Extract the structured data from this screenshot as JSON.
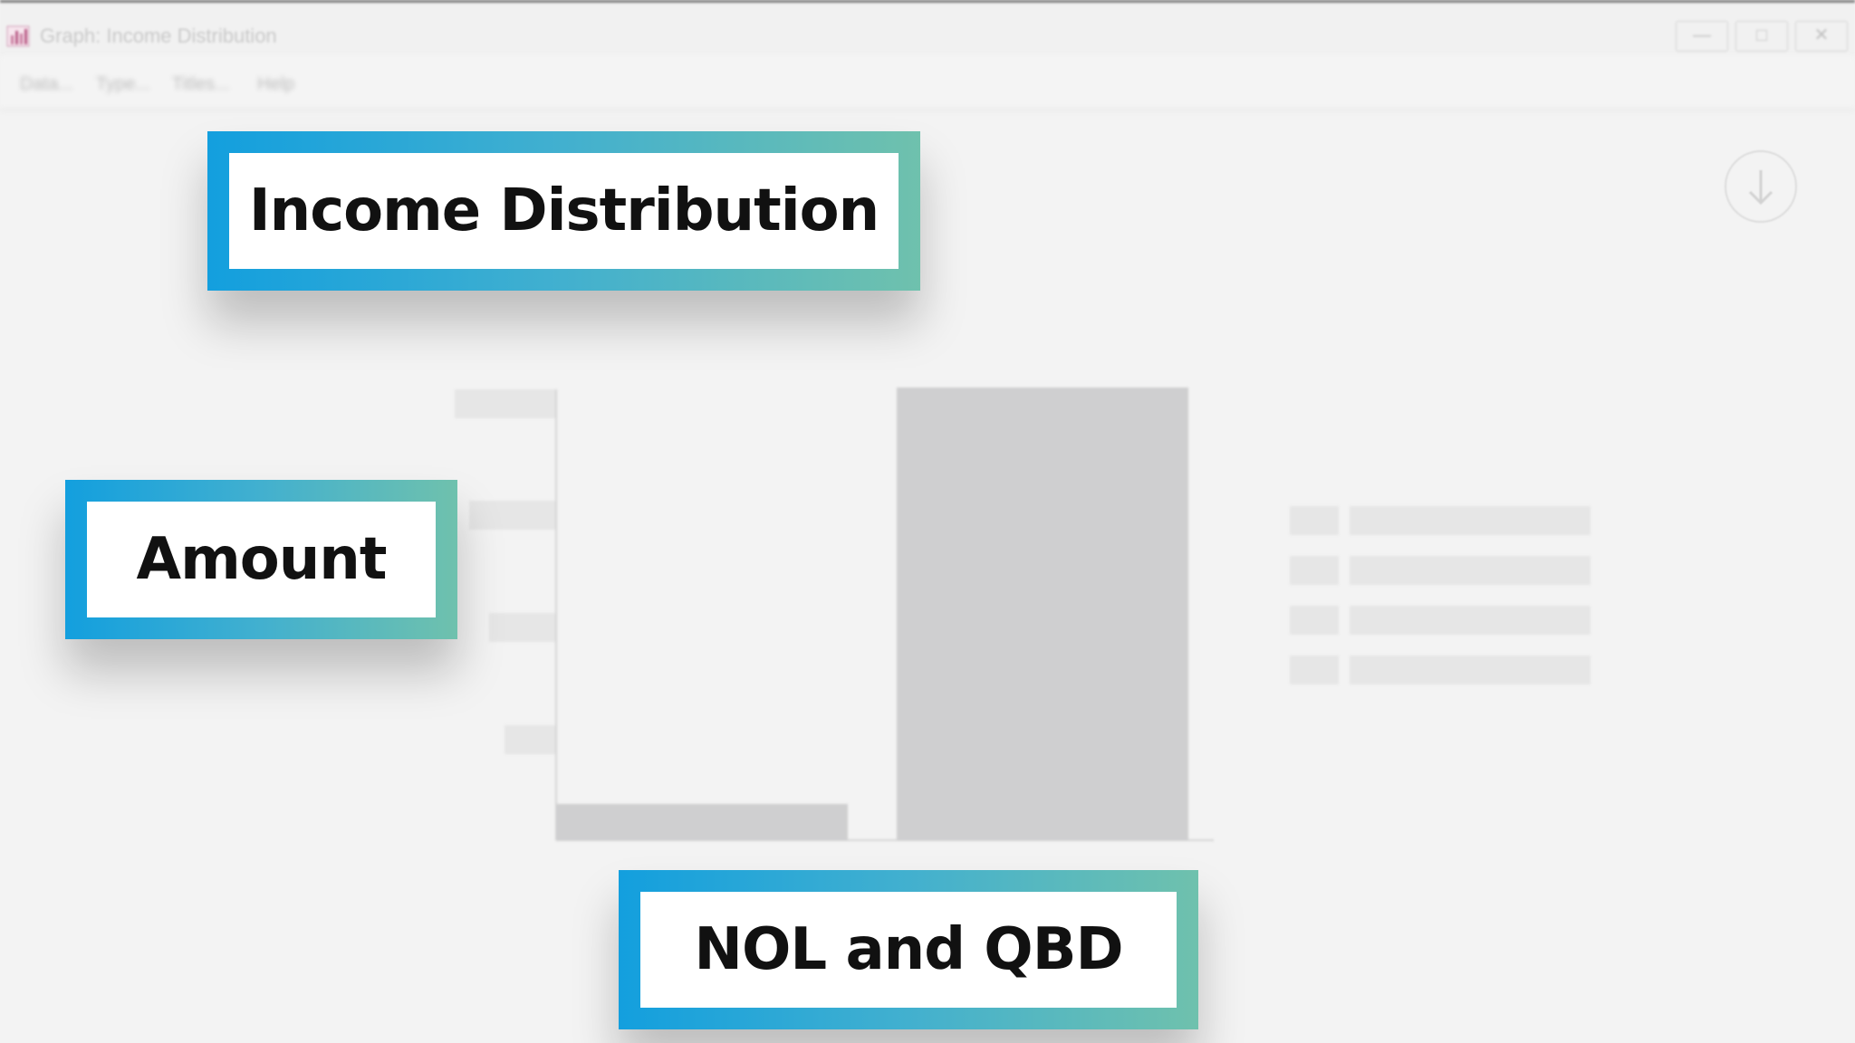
{
  "window": {
    "title": "Graph: Income Distribution",
    "minimize_glyph": "—",
    "maximize_glyph": "□",
    "close_glyph": "✕"
  },
  "menu": [
    "Data...",
    "Type...",
    "Titles...",
    "Help"
  ],
  "chart_data": {
    "type": "bar",
    "title": "Income Distribution",
    "ylabel": "Amount",
    "xlabel": "NOL and QBD",
    "categories": [
      "",
      ""
    ],
    "values": [
      0.08,
      1.0
    ],
    "bar_color": "#cfcfd0"
  },
  "callouts": {
    "title": "Income Distribution",
    "y_axis": "Amount",
    "x_axis": "NOL and QBD"
  },
  "colors": {
    "callout_gradient_start": "#139fde",
    "callout_gradient_end": "#6fc1ad",
    "bar": "#cfcfd0",
    "placeholder": "#e6e6e6"
  }
}
